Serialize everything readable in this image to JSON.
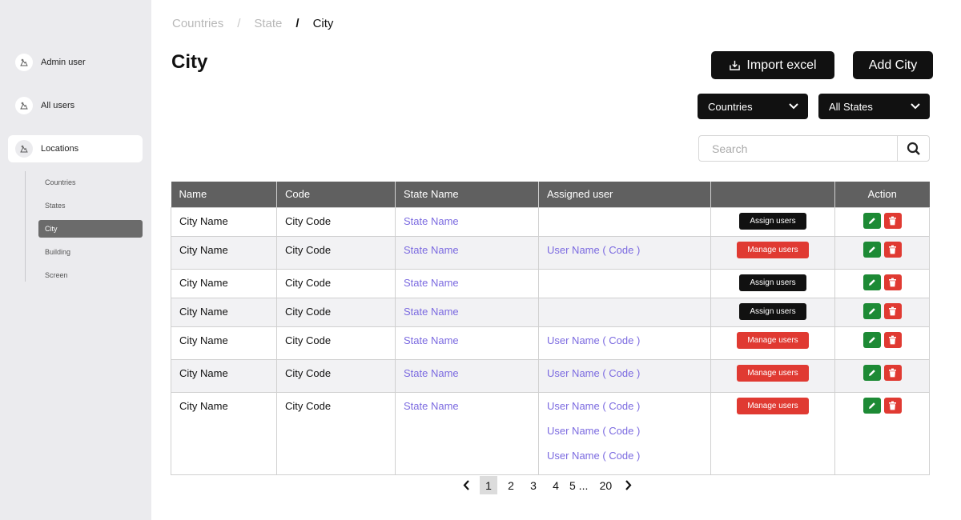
{
  "sidebar": {
    "items": [
      {
        "label": "Admin user"
      },
      {
        "label": "All users"
      },
      {
        "label": "Locations"
      }
    ],
    "subitems": [
      {
        "label": "Countries"
      },
      {
        "label": "States"
      },
      {
        "label": "City"
      },
      {
        "label": "Building"
      },
      {
        "label": "Screen"
      }
    ],
    "active_subitem": "City"
  },
  "breadcrumb": {
    "items": [
      "Countries",
      "State",
      "City"
    ]
  },
  "page_title": "City",
  "toolbar": {
    "import_label": "Import excel",
    "add_label": "Add City"
  },
  "filters": {
    "countries": "Countries",
    "states": "All States"
  },
  "search": {
    "placeholder": "Search"
  },
  "table": {
    "headers": [
      "Name",
      "Code",
      "State Name",
      "Assigned user",
      "",
      "Action"
    ],
    "rows": [
      {
        "name": "City Name",
        "code": "City Code",
        "state": "State Name",
        "users": [],
        "button": "Assign users"
      },
      {
        "name": "City Name",
        "code": "City Code",
        "state": "State Name",
        "users": [
          "User Name ( Code )"
        ],
        "button": "Manage users"
      },
      {
        "name": "City Name",
        "code": "City Code",
        "state": "State Name",
        "users": [],
        "button": "Assign users"
      },
      {
        "name": "City Name",
        "code": "City Code",
        "state": "State Name",
        "users": [],
        "button": "Assign users"
      },
      {
        "name": "City Name",
        "code": "City Code",
        "state": "State Name",
        "users": [
          "User Name ( Code )"
        ],
        "button": "Manage users"
      },
      {
        "name": "City Name",
        "code": "City Code",
        "state": "State Name",
        "users": [
          "User Name ( Code )"
        ],
        "button": "Manage users"
      },
      {
        "name": "City Name",
        "code": "City Code",
        "state": "State Name",
        "users": [
          "User Name ( Code )",
          "User Name ( Code )",
          "User Name ( Code )"
        ],
        "button": "Manage users"
      }
    ]
  },
  "pagination": {
    "pages": [
      "1",
      "2",
      "3",
      "4",
      "5 ...",
      "20"
    ],
    "current": "1"
  },
  "colors": {
    "accent_purple": "#7b6ae0",
    "danger": "#e03a32",
    "edit_green": "#1d8a35",
    "dark": "#111111"
  }
}
